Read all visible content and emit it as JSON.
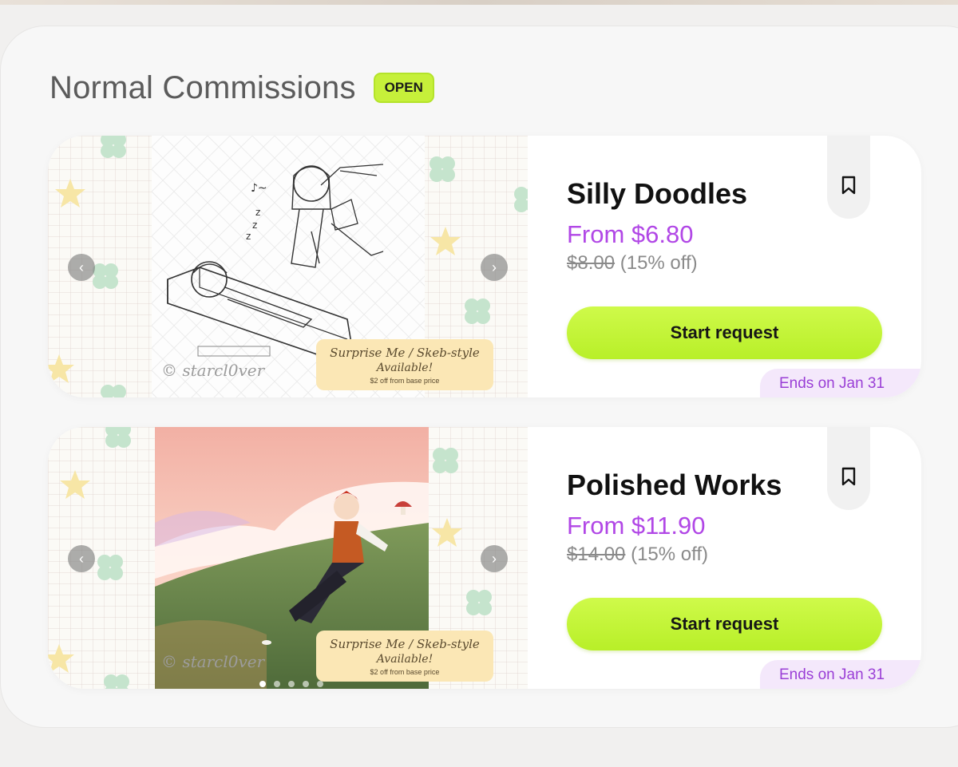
{
  "section": {
    "title": "Normal Commissions",
    "status_badge": "OPEN"
  },
  "cards": [
    {
      "title": "Silly Doodles",
      "price": "From $6.80",
      "original_price": "$8.00",
      "discount": "(15% off)",
      "button_label": "Start request",
      "ends": "Ends on Jan 31",
      "overlay": {
        "line1": "Surprise Me / Skeb-style",
        "line2": "Available!",
        "line3": "$2 off from base price"
      },
      "watermark": "© starcl0ver"
    },
    {
      "title": "Polished Works",
      "price": "From $11.90",
      "original_price": "$14.00",
      "discount": "(15% off)",
      "button_label": "Start request",
      "ends": "Ends on Jan 31",
      "overlay": {
        "line1": "Surprise Me / Skeb-style",
        "line2": "Available!",
        "line3": "$2 off from base price"
      },
      "watermark": "© starcl0ver"
    }
  ],
  "icons": {
    "bookmark": "bookmark-icon",
    "prev": "chevron-left-icon",
    "next": "chevron-right-icon"
  },
  "colors": {
    "accent_green": "#c6f03a",
    "price_purple": "#b147e6",
    "ends_purple": "#9a3fd6"
  },
  "carousel": {
    "slides": 5,
    "active_slide": 1
  }
}
